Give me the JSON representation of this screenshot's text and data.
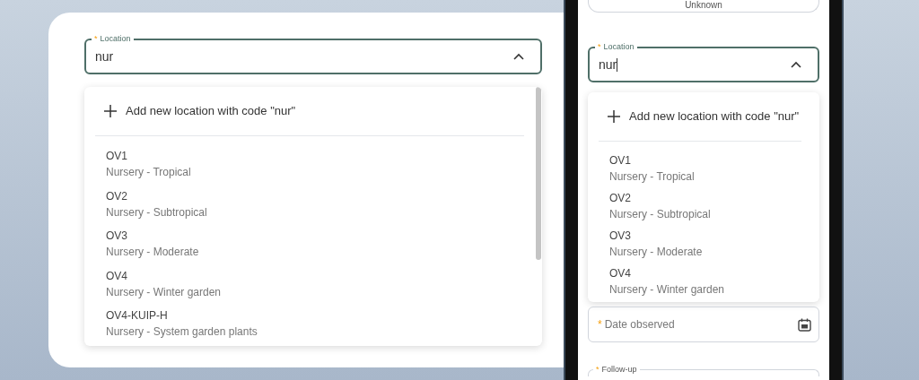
{
  "desktop": {
    "location_field": {
      "required_mark": "*",
      "label": "Location",
      "value": "nur",
      "expanded": true
    },
    "dropdown": {
      "add_option": "Add new location with code \"nur\"",
      "options": [
        {
          "code": "OV1",
          "description": "Nursery - Tropical"
        },
        {
          "code": "OV2",
          "description": "Nursery - Subtropical"
        },
        {
          "code": "OV3",
          "description": "Nursery - Moderate"
        },
        {
          "code": "OV4",
          "description": "Nursery - Winter garden"
        },
        {
          "code": "OV4-KUIP-H",
          "description": "Nursery - System garden plants"
        }
      ]
    }
  },
  "mobile": {
    "top_button": "Unknown",
    "location_field": {
      "required_mark": "*",
      "label": "Location",
      "value": "nur",
      "expanded": true
    },
    "dropdown": {
      "add_option": "Add new location with code \"nur\"",
      "options": [
        {
          "code": "OV1",
          "description": "Nursery - Tropical"
        },
        {
          "code": "OV2",
          "description": "Nursery - Subtropical"
        },
        {
          "code": "OV3",
          "description": "Nursery - Moderate"
        },
        {
          "code": "OV4",
          "description": "Nursery - Winter garden"
        }
      ]
    },
    "date_field": {
      "required_mark": "*",
      "placeholder": "Date observed"
    },
    "follow_up_field": {
      "required_mark": "*",
      "label": "Follow-up"
    }
  }
}
